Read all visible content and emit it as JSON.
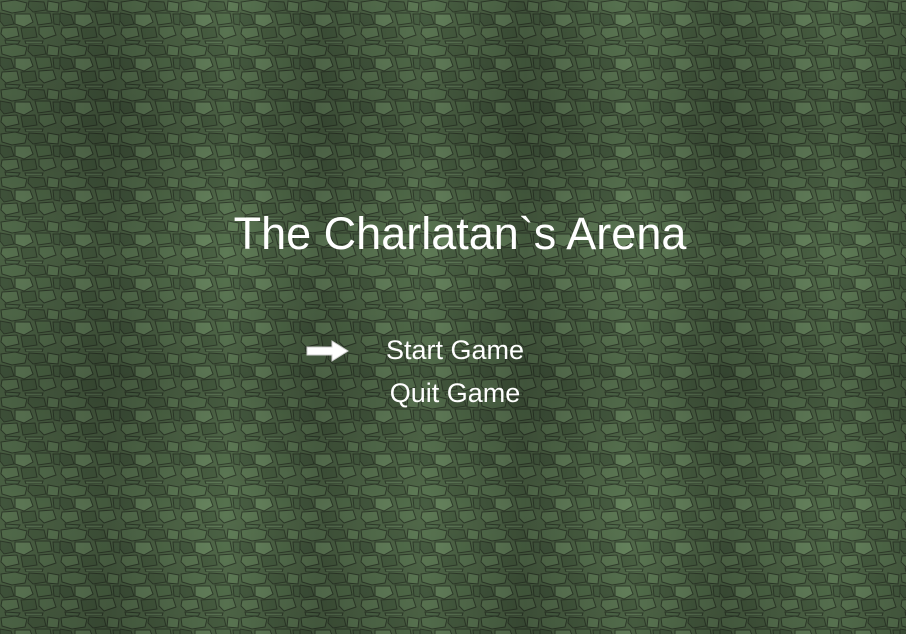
{
  "game": {
    "title": "The Charlatan`s Arena"
  },
  "menu": {
    "items": [
      {
        "label": "Start Game",
        "selected": true
      },
      {
        "label": "Quit Game",
        "selected": false
      }
    ],
    "cursor_icon": "right-arrow-icon"
  },
  "colors": {
    "text": "#ffffff",
    "background_stone_light": "#6f8f63",
    "background_stone_dark": "#3f4f3b"
  }
}
